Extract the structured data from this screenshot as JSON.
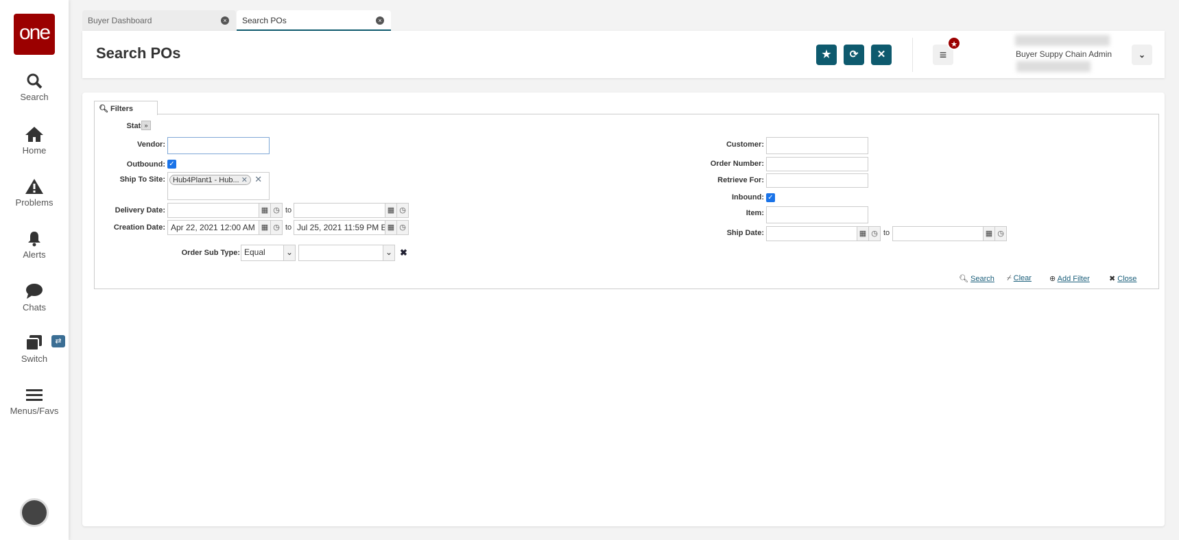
{
  "sidebar": {
    "logo": "one",
    "items": [
      {
        "label": "Search",
        "icon": "search-icon"
      },
      {
        "label": "Home",
        "icon": "home-icon"
      },
      {
        "label": "Problems",
        "icon": "warning-icon"
      },
      {
        "label": "Alerts",
        "icon": "bell-icon"
      },
      {
        "label": "Chats",
        "icon": "chat-icon"
      },
      {
        "label": "Switch",
        "icon": "switch-icon"
      },
      {
        "label": "Menus/Favs",
        "icon": "menu-icon"
      }
    ]
  },
  "tabs": [
    {
      "label": "Buyer Dashboard",
      "active": false
    },
    {
      "label": "Search POs",
      "active": true
    }
  ],
  "header": {
    "title": "Search POs",
    "user_role": "Buyer Suppy Chain Admin",
    "accent": "#0e5a6e"
  },
  "filters": {
    "tab_label": "Filters",
    "left": {
      "state": "State:",
      "vendor": "Vendor:",
      "vendor_value": "",
      "outbound": "Outbound:",
      "outbound_checked": true,
      "ship_to_site": "Ship To Site:",
      "ship_to_site_chip": "Hub4Plant1 - Hub...",
      "delivery_date": "Delivery Date:",
      "delivery_from": "",
      "delivery_to": "",
      "creation_date": "Creation Date:",
      "creation_from": "Apr 22, 2021 12:00 AM",
      "creation_to": "Jul 25, 2021 11:59 PM E",
      "order_sub_type": "Order Sub Type:",
      "order_sub_type_op": "Equal",
      "order_sub_type_value": ""
    },
    "right": {
      "customer": "Customer:",
      "order_number": "Order Number:",
      "retrieve_for": "Retrieve For:",
      "inbound": "Inbound:",
      "inbound_checked": true,
      "item": "Item:",
      "ship_date": "Ship Date:"
    },
    "to": "to",
    "actions": {
      "search": "Search",
      "clear": "Clear",
      "add_filter": "Add Filter",
      "close": "Close"
    }
  }
}
